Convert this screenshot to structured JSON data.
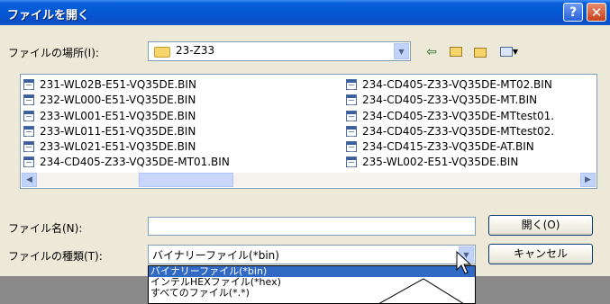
{
  "window": {
    "title": "ファイルを開く",
    "help_label": "?",
    "close_label": "✕"
  },
  "look_in": {
    "label": "ファイルの場所(I):",
    "value": "23-Z33"
  },
  "files": {
    "left": [
      "231-WL02B-E51-VQ35DE.BIN",
      "232-WL000-E51-VQ35DE.BIN",
      "233-WL001-E51-VQ35DE.BIN",
      "233-WL011-E51-VQ35DE.BIN",
      "233-WL021-E51-VQ35DE.BIN",
      "234-CD405-Z33-VQ35DE-MT01.BIN"
    ],
    "right": [
      "234-CD405-Z33-VQ35DE-MT02.BIN",
      "234-CD405-Z33-VQ35DE-MT.BIN",
      "234-CD405-Z33-VQ35DE-MTtest01.",
      "234-CD405-Z33-VQ35DE-MTtest02.",
      "234-CD415-Z33-VQ35DE-AT.BIN",
      "235-WL002-E51-VQ35DE.BIN"
    ]
  },
  "filename": {
    "label": "ファイル名(N):",
    "value": ""
  },
  "filetype": {
    "label": "ファイルの種類(T):",
    "value": "バイナリーファイル(*bin)",
    "options": [
      "バイナリーファイル(*bin)",
      "インテルHEXファイル(*hex)",
      "すべてのファイル(*.*)"
    ]
  },
  "buttons": {
    "open": "開く(O)",
    "cancel": "キャンセル"
  }
}
